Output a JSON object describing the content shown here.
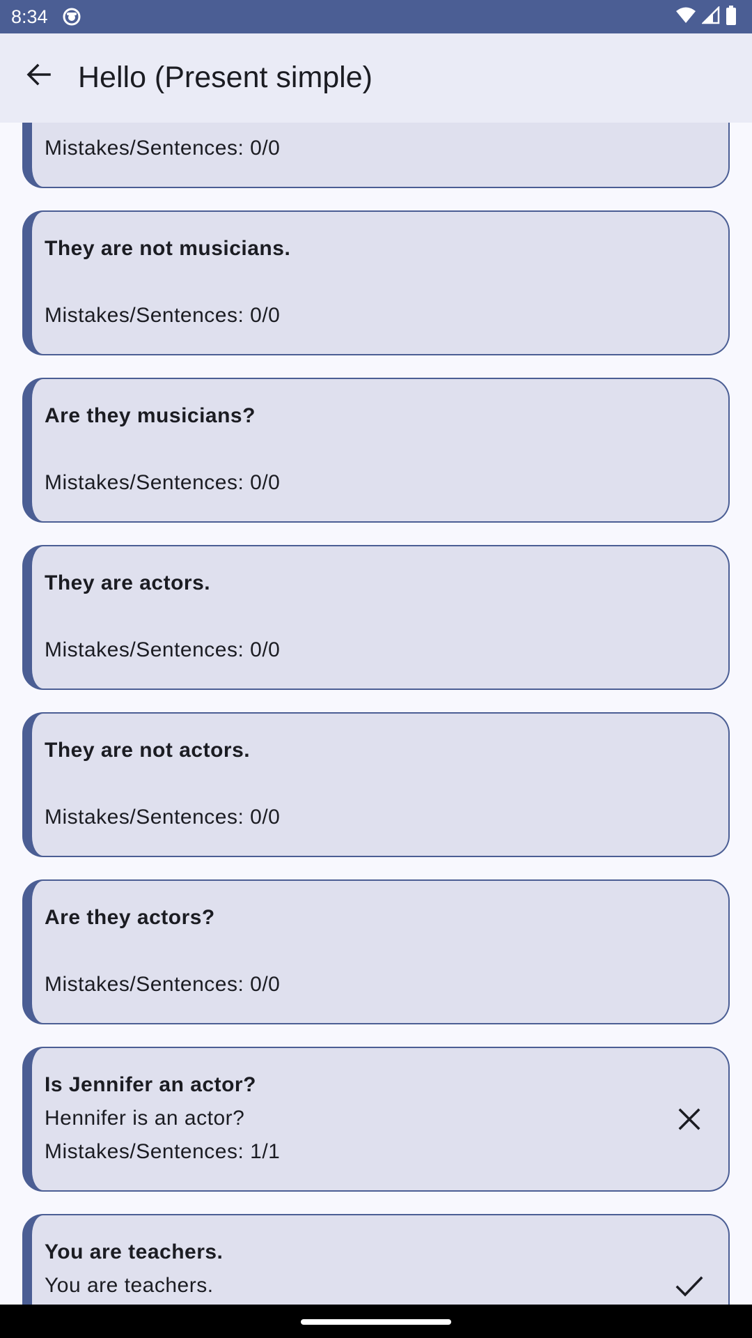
{
  "status_bar": {
    "time": "8:34",
    "app_icon": "android-debug-icon",
    "icons": [
      "wifi-icon",
      "signal-icon",
      "battery-icon"
    ]
  },
  "app_bar": {
    "back_icon": "arrow-back-icon",
    "title": "Hello (Present simple)"
  },
  "cards": [
    {
      "title": "",
      "answer": "",
      "stats": "Mistakes/Sentences: 0/0",
      "status": "none"
    },
    {
      "title": "They are not musicians.",
      "answer": "",
      "stats": "Mistakes/Sentences: 0/0",
      "status": "none"
    },
    {
      "title": "Are they musicians?",
      "answer": "",
      "stats": "Mistakes/Sentences: 0/0",
      "status": "none"
    },
    {
      "title": "They are actors.",
      "answer": "",
      "stats": "Mistakes/Sentences: 0/0",
      "status": "none"
    },
    {
      "title": "They are not actors.",
      "answer": "",
      "stats": "Mistakes/Sentences: 0/0",
      "status": "none"
    },
    {
      "title": "Are they actors?",
      "answer": "",
      "stats": "Mistakes/Sentences: 0/0",
      "status": "none"
    },
    {
      "title": "Is Jennifer an actor?",
      "answer": "Hennifer is an actor?",
      "stats": "Mistakes/Sentences: 1/1",
      "status": "wrong"
    },
    {
      "title": "You are teachers.",
      "answer": "You are teachers.",
      "stats": "",
      "status": "correct"
    }
  ],
  "colors": {
    "primary": "#4b5e94",
    "card_background": "#dfe0ee",
    "app_bar_background": "#eaebf6",
    "page_background": "#f8f8fe",
    "text": "#1b1c22"
  }
}
